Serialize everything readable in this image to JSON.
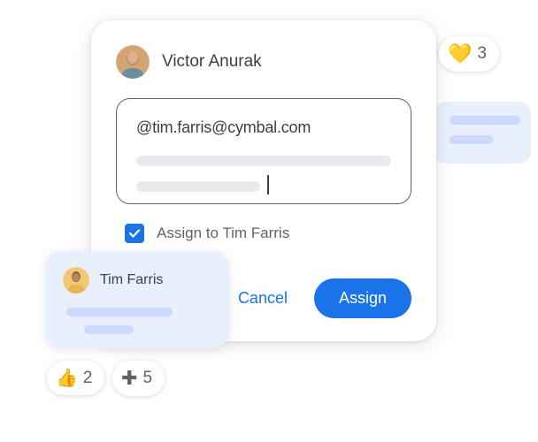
{
  "author": {
    "name": "Victor Anurak"
  },
  "input": {
    "mention": "@tim.farris@cymbal.com"
  },
  "assign": {
    "label": "Assign to Tim Farris"
  },
  "buttons": {
    "cancel": "Cancel",
    "assign": "Assign"
  },
  "suggestion": {
    "name": "Tim Farris"
  },
  "reactions": {
    "heart": {
      "emoji": "💛",
      "count": "3"
    },
    "thumbs": {
      "emoji": "👍",
      "count": "2"
    },
    "plus": {
      "count": "5"
    }
  }
}
